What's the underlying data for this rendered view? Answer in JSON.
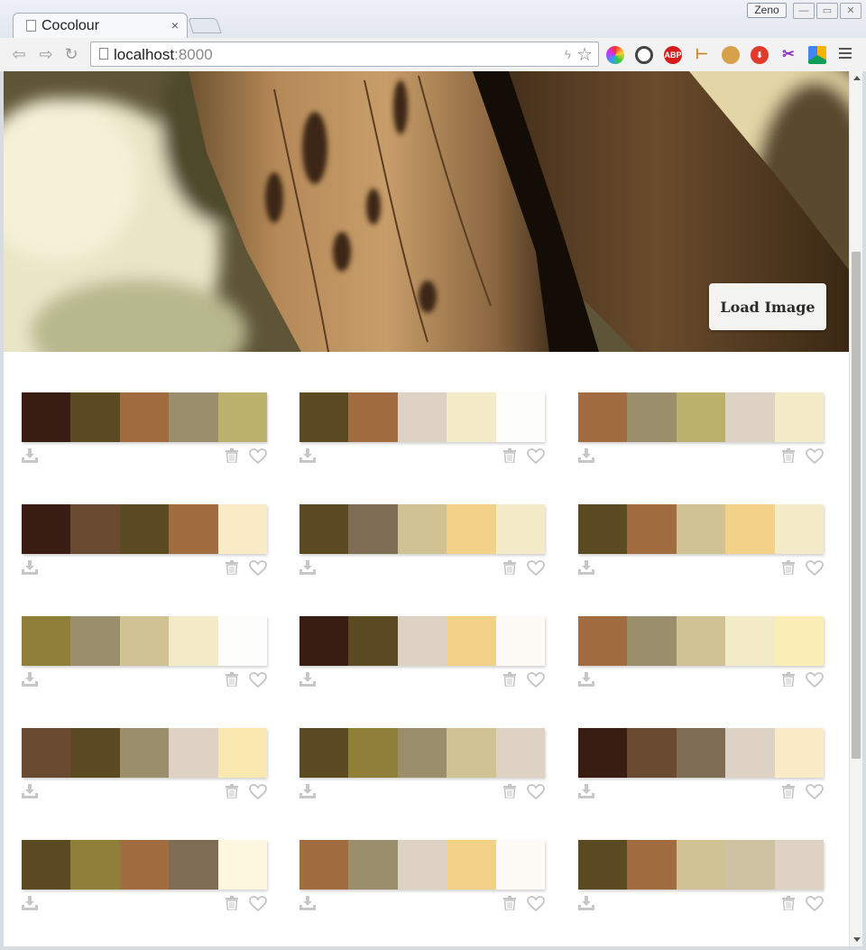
{
  "browser": {
    "tab_title": "Cocolour",
    "tab_close": "×",
    "profile_name": "Zeno",
    "url_host": "localhost",
    "url_port": ":8000"
  },
  "page": {
    "load_button": "Load Image"
  },
  "palettes": [
    [
      "#3a1d12",
      "#5b4a22",
      "#a06c40",
      "#9b8e6a",
      "#bbb06c"
    ],
    [
      "#5b4a22",
      "#a06c40",
      "#ddd2c4",
      "#f3ebc8",
      "#fdfdfb"
    ],
    [
      "#a06c40",
      "#9b8e6a",
      "#bbb06c",
      "#ddd2c4",
      "#f3ebc8"
    ],
    [
      "#3a1d12",
      "#6a4b31",
      "#5b4a22",
      "#a06c40",
      "#f8ebc5"
    ],
    [
      "#5b4a22",
      "#7e6c55",
      "#d1c293",
      "#f1d288",
      "#f3ebc8"
    ],
    [
      "#5b4a22",
      "#a06c40",
      "#d1c293",
      "#f1d288",
      "#f3ebc8"
    ],
    [
      "#8f7f38",
      "#9b8e6a",
      "#d1c293",
      "#f3ebc8",
      "#fdfdfb"
    ],
    [
      "#3a1d12",
      "#5b4a22",
      "#ddd2c4",
      "#f1d288",
      "#fefbf7"
    ],
    [
      "#a06c40",
      "#9b8e6a",
      "#d1c293",
      "#f3ebc8",
      "#faeeb6"
    ],
    [
      "#6a4b31",
      "#5b4a22",
      "#9b8e6a",
      "#ddd2c4",
      "#f9e8af"
    ],
    [
      "#5b4a22",
      "#8f7f38",
      "#9b8e6a",
      "#d1c293",
      "#ddd2c4"
    ],
    [
      "#3a1d12",
      "#6a4b31",
      "#7e6c55",
      "#ddd2c4",
      "#f8ebc5"
    ],
    [
      "#5b4a22",
      "#8f7f38",
      "#a06c40",
      "#7e6c55",
      "#fef7e0"
    ],
    [
      "#a06c40",
      "#9b8e6a",
      "#ddd2c4",
      "#f1d288",
      "#fefbf7"
    ],
    [
      "#5b4a22",
      "#a06c40",
      "#d1c293",
      "#cfc2a3",
      "#ddd2c4"
    ]
  ],
  "icons": {
    "download": "download-icon",
    "delete": "trash-icon",
    "favorite": "heart-icon"
  }
}
